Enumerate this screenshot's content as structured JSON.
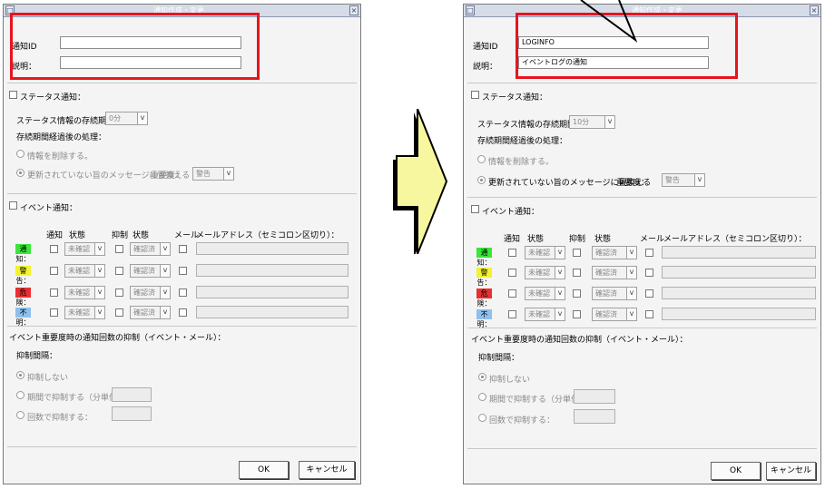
{
  "dialogs": {
    "before": {
      "title": "通知作成・変更",
      "fields": {
        "id_label": "通知ID",
        "id_value": "",
        "desc_label": "説明：",
        "desc_value": ""
      },
      "status": {
        "checkbox_label": "ステータス通知：",
        "retention_label": "ステータス情報の存続期間：",
        "retention_value": "0分",
        "after_label": "存続期間経過後の処理：",
        "opt_delete": "情報を削除する。",
        "opt_replace": "更新されていない旨のメッセージに置換える",
        "severity_label": "重要度：",
        "severity_value": "警告"
      },
      "event": {
        "checkbox_label": "イベント通知：",
        "headers": {
          "notify": "通知",
          "state": "状態",
          "suppress": "抑制",
          "state2": "状態",
          "mail": "メール",
          "address": "メールアドレス（セミコロン区切り）："
        },
        "rows": [
          {
            "label": "通知：",
            "color": "#39e639",
            "state": "未確認",
            "state2": "確認済"
          },
          {
            "label": "警告：",
            "color": "#f2f230",
            "state": "未確認",
            "state2": "確認済"
          },
          {
            "label": "危険：",
            "color": "#e83030",
            "state": "未確認",
            "state2": "確認済"
          },
          {
            "label": "不明：",
            "color": "#8fc0ec",
            "state": "未確認",
            "state2": "確認済"
          }
        ]
      },
      "suppress": {
        "title": "イベント重要度時の通知回数の抑制（イベント・メール）：",
        "period_label": "抑制間隔：",
        "opt_none": "抑制しない",
        "opt_period": "期間で抑制する（分単位）",
        "opt_count": "回数で抑制する："
      },
      "buttons": {
        "ok": "OK",
        "cancel": "キャンセル"
      }
    },
    "after": {
      "title": "通知作成・変更",
      "fields": {
        "id_label": "通知ID",
        "id_value": "LOGINFO",
        "desc_label": "説明：",
        "desc_value": "イベントログの通知"
      },
      "status": {
        "checkbox_label": "ステータス通知：",
        "retention_label": "ステータス情報の存続期間：",
        "retention_value": "10分",
        "after_label": "存続期間経過後の処理：",
        "opt_delete": "情報を削除する。",
        "opt_replace": "更新されていない旨のメッセージに置換える",
        "severity_label": "重要度：",
        "severity_value": "警告"
      },
      "event": {
        "checkbox_label": "イベント通知：",
        "headers": {
          "notify": "通知",
          "state": "状態",
          "suppress": "抑制",
          "state2": "状態",
          "mail": "メール",
          "address": "メールアドレス（セミコロン区切り）："
        },
        "rows": [
          {
            "label": "通知：",
            "color": "#39e639",
            "state": "未確認",
            "state2": "確認済"
          },
          {
            "label": "警告：",
            "color": "#f2f230",
            "state": "未確認",
            "state2": "確認済"
          },
          {
            "label": "危険：",
            "color": "#e83030",
            "state": "未確認",
            "state2": "確認済"
          },
          {
            "label": "不明：",
            "color": "#8fc0ec",
            "state": "未確認",
            "state2": "確認済"
          }
        ]
      },
      "suppress": {
        "title": "イベント重要度時の通知回数の抑制（イベント・メール）：",
        "period_label": "抑制間隔：",
        "opt_none": "抑制しない",
        "opt_period": "期間で抑制する（分単位）",
        "opt_count": "回数で抑制する："
      },
      "buttons": {
        "ok": "OK",
        "cancel": "キャンセル"
      }
    }
  },
  "colors": {
    "highlight": "#e8141e",
    "arrow_fill": "#f7f7a0",
    "titlebar": "#d5dbe7"
  }
}
